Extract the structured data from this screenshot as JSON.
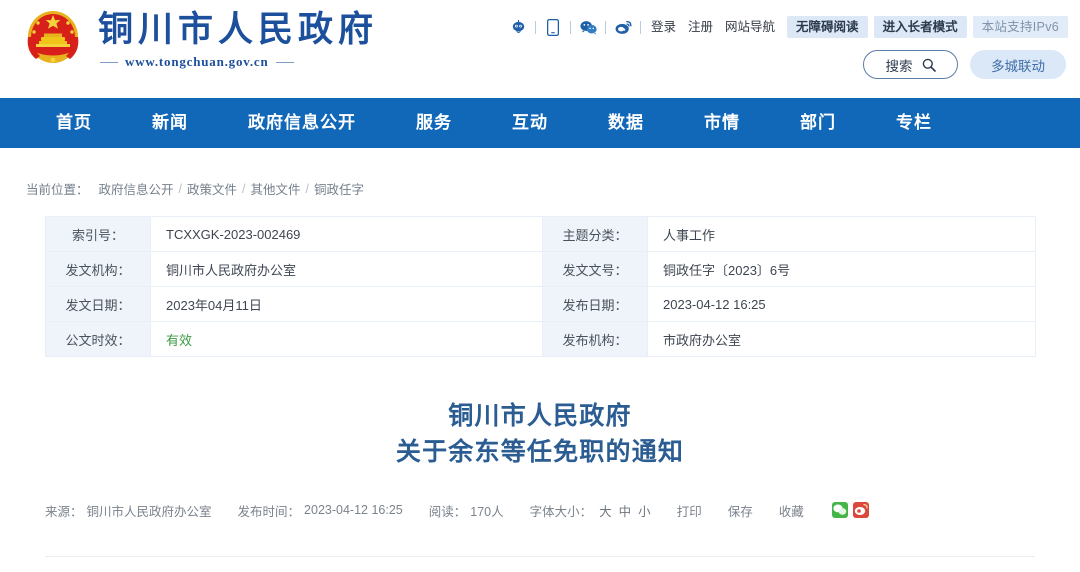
{
  "header": {
    "site_title": "铜川市人民政府",
    "site_url": "www.tongchuan.gov.cn",
    "emblem_icon": "national-emblem-icon",
    "utility_icons": [
      {
        "name": "robot-assistant-icon"
      },
      {
        "name": "mobile-phone-icon"
      },
      {
        "name": "wechat-icon"
      },
      {
        "name": "weibo-icon"
      }
    ],
    "links": [
      {
        "label": "登录",
        "name": "login-link"
      },
      {
        "label": "注册",
        "name": "register-link"
      },
      {
        "label": "网站导航",
        "name": "site-nav-link"
      }
    ],
    "pills": [
      {
        "label": "无障碍阅读",
        "name": "accessibility-reading-button"
      },
      {
        "label": "进入长者模式",
        "name": "elder-mode-button"
      }
    ],
    "ipv6_badge": "本站支持IPv6",
    "search_label": "搜索",
    "search_icon": "search-icon",
    "multi_city_label": "多城联动"
  },
  "nav": {
    "items": [
      {
        "label": "首页",
        "name": "nav-item-home"
      },
      {
        "label": "新闻",
        "name": "nav-item-news"
      },
      {
        "label": "政府信息公开",
        "name": "nav-item-government-info"
      },
      {
        "label": "服务",
        "name": "nav-item-services"
      },
      {
        "label": "互动",
        "name": "nav-item-interaction"
      },
      {
        "label": "数据",
        "name": "nav-item-data"
      },
      {
        "label": "市情",
        "name": "nav-item-city-profile"
      },
      {
        "label": "部门",
        "name": "nav-item-departments"
      },
      {
        "label": "专栏",
        "name": "nav-item-columns"
      }
    ]
  },
  "breadcrumb": {
    "label": "当前位置：",
    "items": [
      "政府信息公开",
      "政策文件",
      "其他文件",
      "铜政任字"
    ],
    "separator": "/"
  },
  "meta_table": {
    "rows": [
      {
        "left_key": "索引号：",
        "left_value": "TCXXGK-2023-002469",
        "right_key": "主题分类：",
        "right_value": "人事工作"
      },
      {
        "left_key": "发文机构：",
        "left_value": "铜川市人民政府办公室",
        "right_key": "发文文号：",
        "right_value": "铜政任字〔2023〕6号"
      },
      {
        "left_key": "发文日期：",
        "left_value": "2023年04月11日",
        "right_key": "发布日期：",
        "right_value": "2023-04-12 16:25"
      },
      {
        "left_key": "公文时效：",
        "left_value": "有效",
        "right_key": "发布机构：",
        "right_value": "市政府办公室"
      }
    ]
  },
  "article": {
    "title_line1": "铜川市人民政府",
    "title_line2": "关于余东等任免职的通知",
    "title_color": "#2b5d92"
  },
  "info_bar": {
    "source_label": "来源：",
    "source_value": "铜川市人民政府办公室",
    "publish_label": "发布时间：",
    "publish_value": "2023-04-12 16:25",
    "views_label": "阅读：",
    "views_value": "170人",
    "fontsize_label": "字体大小：",
    "fontsize_options": [
      "大",
      "中",
      "小"
    ],
    "print_label": "打印",
    "save_label": "保存",
    "favorite_label": "收藏",
    "share_icons": [
      {
        "name": "wechat-share-icon",
        "color": "#44b549"
      },
      {
        "name": "weibo-share-icon",
        "color": "#d9483b"
      }
    ]
  },
  "colors": {
    "brand_blue": "#1c4f9c",
    "nav_blue": "#1268b8",
    "meta_key_bg": "#eef4fa",
    "valid_green": "#3d9a46"
  }
}
